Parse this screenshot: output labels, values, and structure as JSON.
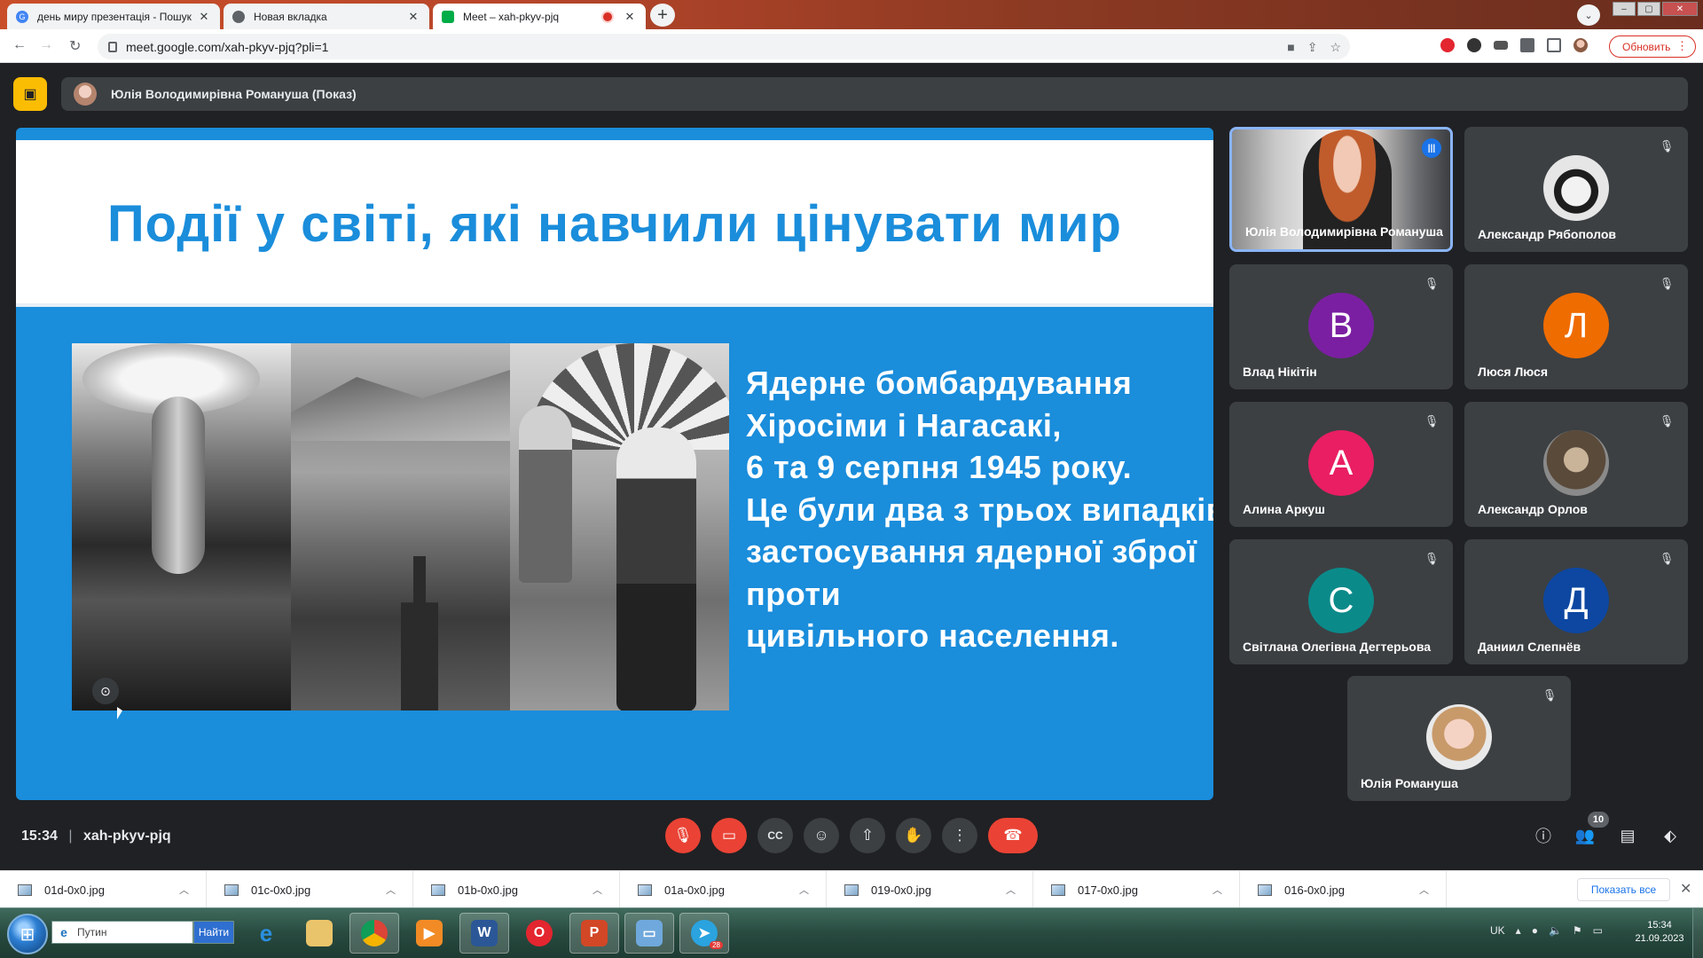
{
  "browser": {
    "tabs": [
      {
        "title": "день миру презентація - Пошук",
        "favicon_color": "#4285f4"
      },
      {
        "title": "Новая вкладка",
        "favicon_color": "#5f6368"
      },
      {
        "title": "Meet – xah-pkyv-pjq",
        "favicon_color": "#00ac47",
        "active": true
      }
    ],
    "new_tab_label": "+",
    "tab_search_label": "⌄",
    "url": "meet.google.com/xah-pkyv-pjq?pli=1",
    "update_button": "Обновить"
  },
  "meet": {
    "presenter_bar": "Юлія Володимирівна Романуша (Показ)",
    "slide": {
      "title": "Події у світі, які навчили цінувати мир",
      "body_lines": [
        "Ядерне бомбардування",
        "Хіросіми і Нагасакі,",
        "6 та 9 серпня 1945 року.",
        "Це були два з трьох випадків",
        "застосування ядерної зброї",
        "проти",
        "цивільного населення."
      ]
    },
    "participants": [
      {
        "name": "Юлія Володимирівна Романуша",
        "type": "video",
        "speaking": true
      },
      {
        "name": "Александр Рябополов",
        "type": "photo",
        "muted": true
      },
      {
        "name": "Влад Нікітін",
        "letter": "В",
        "color": "#7b1fa2",
        "muted": true
      },
      {
        "name": "Люся Люся",
        "letter": "Л",
        "color": "#ef6c00",
        "muted": true
      },
      {
        "name": "Алина Аркуш",
        "letter": "А",
        "color": "#e91e63",
        "muted": true
      },
      {
        "name": "Александр Орлов",
        "type": "photo",
        "muted": true
      },
      {
        "name": "Світлана Олегівна Дегтерьова",
        "letter": "С",
        "color": "#0b8a8a",
        "muted": true
      },
      {
        "name": "Даниил Слепнёв",
        "letter": "Д",
        "color": "#0d47a1",
        "muted": true
      },
      {
        "name": "Юлія Романуша",
        "type": "photo",
        "muted": true
      }
    ],
    "time": "15:34",
    "meeting_code": "xah-pkyv-pjq",
    "participant_count": "10"
  },
  "downloads": {
    "items": [
      "01d-0x0.jpg",
      "01c-0x0.jpg",
      "01b-0x0.jpg",
      "01a-0x0.jpg",
      "019-0x0.jpg",
      "017-0x0.jpg",
      "016-0x0.jpg"
    ],
    "show_all": "Показать все"
  },
  "taskbar": {
    "search_value": "Путин",
    "find_button": "Найти",
    "language": "UK",
    "clock_time": "15:34",
    "clock_date": "21.09.2023",
    "telegram_badge": "28"
  }
}
